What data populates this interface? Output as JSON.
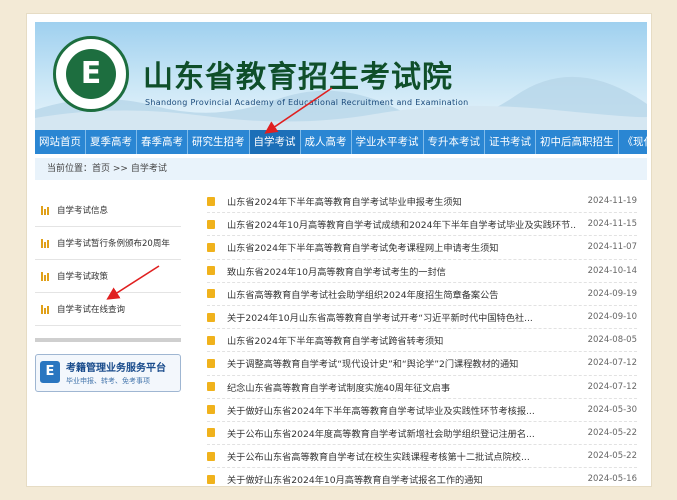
{
  "site": {
    "title": "山东省教育招生考试院",
    "subtitle": "Shandong Provincial Academy of Educational Recruitment and Examination",
    "emblem_letter": "E"
  },
  "nav": {
    "items": [
      {
        "label": "网站首页"
      },
      {
        "label": "夏季高考"
      },
      {
        "label": "春季高考"
      },
      {
        "label": "研究生招考"
      },
      {
        "label": "自学考试"
      },
      {
        "label": "成人高考"
      },
      {
        "label": "学业水平考试"
      },
      {
        "label": "专升本考试"
      },
      {
        "label": "证书考试"
      },
      {
        "label": "初中后高职招生"
      },
      {
        "label": "《现代教育》"
      }
    ],
    "active_index": 4
  },
  "breadcrumb": {
    "prefix": "当前位置：",
    "home": "首页",
    "sep": " >> ",
    "current": "自学考试"
  },
  "sidebar": {
    "items": [
      {
        "label": "自学考试信息"
      },
      {
        "label": "自学考试暂行条例颁布20周年"
      },
      {
        "label": "自学考试政策"
      },
      {
        "label": "自学考试在线查询"
      }
    ],
    "banner": {
      "title": "考籍管理业务服务平台",
      "subtitle": "毕业申报、转考、免考事项"
    }
  },
  "news": [
    {
      "title": "山东省2024年下半年高等教育自学考试毕业申报考生须知",
      "date": "2024-11-19"
    },
    {
      "title": "山东省2024年10月高等教育自学考试成绩和2024年下半年自学考试毕业及实践环节...",
      "date": "2024-11-15"
    },
    {
      "title": "山东省2024年下半年高等教育自学考试免考课程网上申请考生须知",
      "date": "2024-11-07"
    },
    {
      "title": "致山东省2024年10月高等教育自学考试考生的一封信",
      "date": "2024-10-14"
    },
    {
      "title": "山东省高等教育自学考试社会助学组织2024年度招生简章备案公告",
      "date": "2024-09-19"
    },
    {
      "title": "关于2024年10月山东省高等教育自学考试开考“习近平新时代中国特色社...",
      "date": "2024-09-10"
    },
    {
      "title": "山东省2024年下半年高等教育自学考试跨省转考须知",
      "date": "2024-08-05"
    },
    {
      "title": "关于调整高等教育自学考试“现代设计史”和“舆论学”2门课程教材的通知",
      "date": "2024-07-12"
    },
    {
      "title": "纪念山东省高等教育自学考试制度实施40周年征文启事",
      "date": "2024-07-12"
    },
    {
      "title": "关于做好山东省2024年下半年高等教育自学考试毕业及实践性环节考核报...",
      "date": "2024-05-30"
    },
    {
      "title": "关于公布山东省2024年度高等教育自学考试新增社会助学组织登记注册名...",
      "date": "2024-05-22"
    },
    {
      "title": "关于公布山东省高等教育自学考试在校生实践课程考核第十二批试点院校...",
      "date": "2024-05-22"
    },
    {
      "title": "关于做好山东省2024年10月高等教育自学考试报名工作的通知",
      "date": "2024-05-16"
    }
  ],
  "colors": {
    "nav_bg": "#2a86d3",
    "title_green": "#0f4f2a",
    "icon_gold": "#f0b21c",
    "arrow_red": "#e02020"
  }
}
